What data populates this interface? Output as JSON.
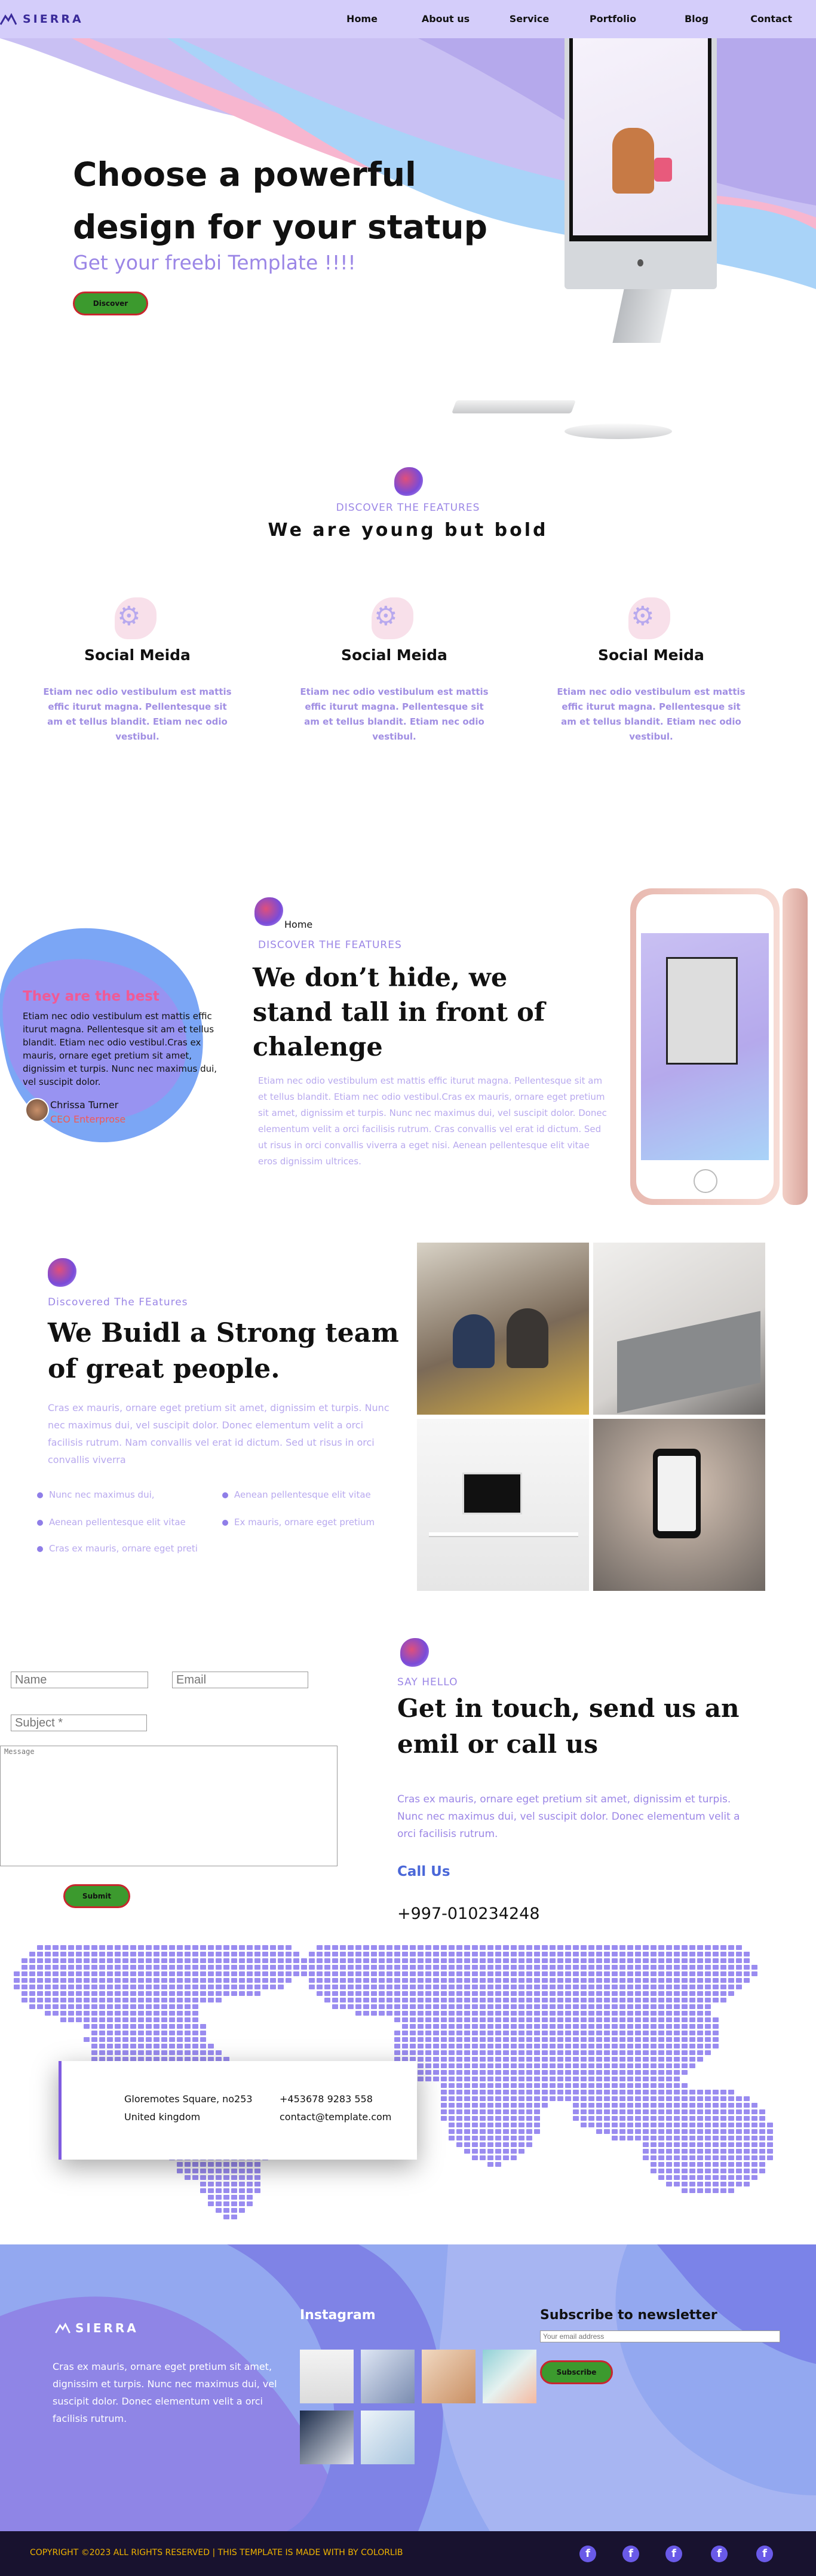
{
  "brand": {
    "name": "SIERRA"
  },
  "nav": [
    {
      "label": "Home"
    },
    {
      "label": "About us"
    },
    {
      "label": "Service"
    },
    {
      "label": "Portfolio"
    },
    {
      "label": "Blog"
    },
    {
      "label": "Contact"
    }
  ],
  "hero": {
    "title": "Choose a powerful design for your statup",
    "subtitle": "Get your freebi Template !!!!",
    "button": "Discover"
  },
  "features": {
    "eyebrow": "DISCOVER THE FEATURES",
    "heading": "We are young but bold",
    "items": [
      {
        "title": "Social Meida",
        "text": "Etiam nec odio vestibulum est mattis effic iturut magna. Pellentesque sit am et tellus blandit. Etiam nec odio vestibul."
      },
      {
        "title": "Social Meida",
        "text": "Etiam nec odio vestibulum est mattis effic iturut magna. Pellentesque sit am et tellus blandit. Etiam nec odio vestibul."
      },
      {
        "title": "Social Meida",
        "text": "Etiam nec odio vestibulum est mattis effic iturut magna. Pellentesque sit am et tellus blandit. Etiam nec odio vestibul."
      }
    ]
  },
  "about": {
    "testimonial_title": "They are the best",
    "testimonial_text": "Etiam nec odio vestibulum est mattis effic iturut magna. Pellentesque sit am et tellus blandit. Etiam nec odio vestibul.Cras ex mauris, ornare eget pretium sit amet, dignissim et turpis. Nunc nec maximus dui, vel suscipit dolor.",
    "author_name": "Chrissa Turner",
    "author_role": "CEO Enterprose",
    "breadcrumb": "Home",
    "eyebrow": "DISCOVER THE FEATURES",
    "heading": "We don’t hide, we stand tall in front of chalenge",
    "text": "Etiam nec odio vestibulum est mattis effic iturut magna. Pellentesque sit am et tellus blandit. Etiam nec odio vestibul.Cras ex mauris, ornare eget pretium sit amet, dignissim et turpis. Nunc nec maximus dui, vel suscipit dolor. Donec elementum velit a orci facilisis rutrum. Cras convallis vel erat id dictum. Sed ut risus in orci convallis viverra a eget nisi. Aenean pellentesque elit vitae eros dignissim ultrices."
  },
  "team": {
    "eyebrow": "Discovered The FEatures",
    "heading": "We Buidl a Strong team of great people.",
    "text": "Cras ex mauris, ornare eget pretium sit amet, dignissim et turpis. Nunc nec maximus dui, vel suscipit dolor. Donec elementum velit a orci facilisis rutrum. Nam convallis vel erat id dictum. Sed ut risus in orci convallis viverra",
    "bullets": [
      "Nunc nec maximus dui,",
      "Aenean pellentesque elit vitae",
      "Aenean pellentesque elit vitae",
      "Ex mauris, ornare eget pretium",
      "Cras ex mauris, ornare eget preti"
    ]
  },
  "contact": {
    "name_placeholder": "Name",
    "email_placeholder": "Email",
    "subject_placeholder": "Subject *",
    "message_placeholder": "Message",
    "submit": "Submit",
    "eyebrow": "SAY HELLO",
    "heading": "Get in touch, send us an emil or call us",
    "text": "Cras ex mauris, ornare eget pretium sit amet, dignissim et turpis. Nunc nec maximus dui, vel suscipit dolor. Donec elementum velit a orci facilisis rutrum.",
    "call_label": "Call Us",
    "phone": "+997-010234248"
  },
  "address_card": {
    "line1": "Gloremotes Square, no253",
    "line2": "United kingdom",
    "phone": "+453678 9283 558",
    "email": "contact@template.com"
  },
  "footer": {
    "brand": "SIERRA",
    "text": "Cras ex mauris, ornare eget pretium sit amet, dignissim et turpis. Nunc nec maximus dui, vel suscipit dolor. Donec elementum velit a orci facilisis rutrum.",
    "instagram_title": "Instagram",
    "newsletter_title": "Subscribe to newsletter",
    "newsletter_placeholder": "Your email address",
    "subscribe_button": "Subscribe",
    "copyright": "COPYRIGHT ©2023 ALL RIGHTS RESERVED | THIS TEMPLATE IS MADE WITH BY COLORLIB",
    "social_icons": [
      "facebook-icon",
      "facebook-icon",
      "facebook-icon",
      "facebook-icon",
      "facebook-icon"
    ]
  }
}
